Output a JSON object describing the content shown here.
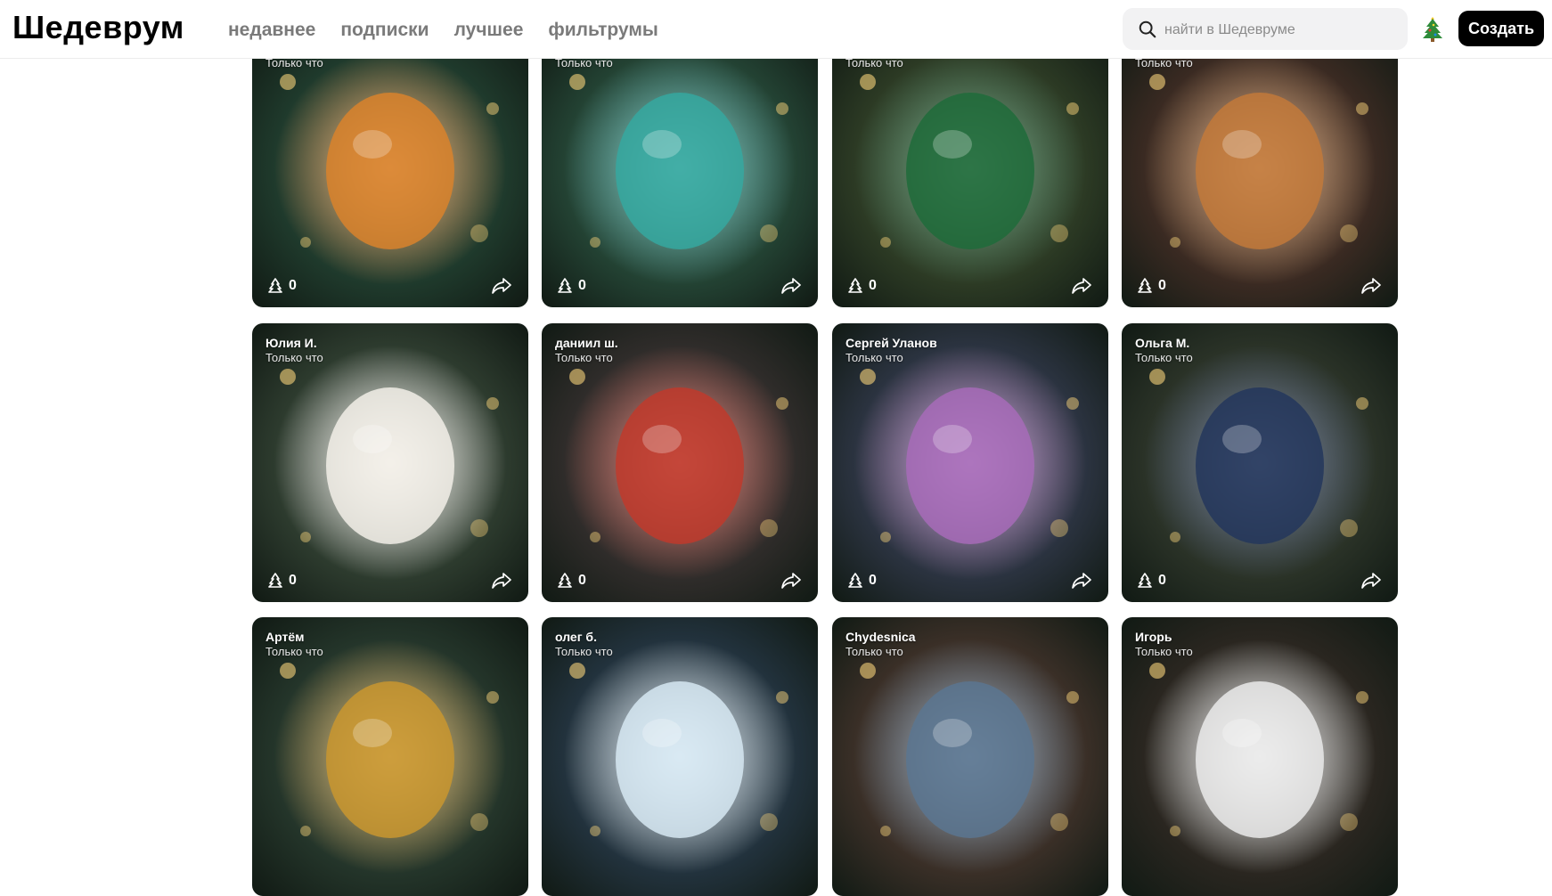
{
  "app": {
    "logo": "Шедеврум"
  },
  "nav": [
    {
      "label": "недавнее"
    },
    {
      "label": "подписки"
    },
    {
      "label": "лучшее"
    },
    {
      "label": "фильтрумы"
    }
  ],
  "search": {
    "placeholder": "найти в Шедевруме"
  },
  "header": {
    "create_label": "Создать"
  },
  "cards": [
    {
      "author": "",
      "time": "Только что",
      "likes": "0",
      "subject": "alien-ornament",
      "bg": "#1f3a2c",
      "accent": "#d9822b"
    },
    {
      "author": "",
      "time": "Только что",
      "likes": "0",
      "subject": "santa-figurine",
      "bg": "#234233",
      "accent": "#35a8a0"
    },
    {
      "author": "",
      "time": "Только что",
      "likes": "0",
      "subject": "dragon-ball-ornament",
      "bg": "#2c3a24",
      "accent": "#1f6b3a"
    },
    {
      "author": "",
      "time": "Только что",
      "likes": "0",
      "subject": "snake-figurine",
      "bg": "#3a2a22",
      "accent": "#c2793a"
    },
    {
      "author": "Юлия И.",
      "time": "Только что",
      "likes": "0",
      "subject": "cat-ornament",
      "bg": "#2d3b2e",
      "accent": "#f2efe8"
    },
    {
      "author": "даниил ш.",
      "time": "Только что",
      "likes": "0",
      "subject": "girl-figurine",
      "bg": "#2f2c2a",
      "accent": "#c0392b"
    },
    {
      "author": "Сергей Уланов",
      "time": "Только что",
      "likes": "0",
      "subject": "fish-ornament",
      "bg": "#2b3340",
      "accent": "#a76bb8"
    },
    {
      "author": "Ольга М.",
      "time": "Только что",
      "likes": "0",
      "subject": "dachshund-figurine",
      "bg": "#2a3227",
      "accent": "#23365c"
    },
    {
      "author": "Артём",
      "time": "Только что",
      "likes": "",
      "subject": "eagle-medallion-ornament",
      "bg": "#24352a",
      "accent": "#c9962f"
    },
    {
      "author": "олег б.",
      "time": "Только что",
      "likes": "",
      "subject": "penguins-ice-ornament",
      "bg": "#22323d",
      "accent": "#d6e7f2"
    },
    {
      "author": "Chydesnica",
      "time": "Только что",
      "likes": "",
      "subject": "mouse-figurine",
      "bg": "#3a2f27",
      "accent": "#5b7591"
    },
    {
      "author": "Игорь",
      "time": "Только что",
      "likes": "",
      "subject": "sports-car-toy",
      "bg": "#2a2620",
      "accent": "#eaeaea"
    }
  ]
}
